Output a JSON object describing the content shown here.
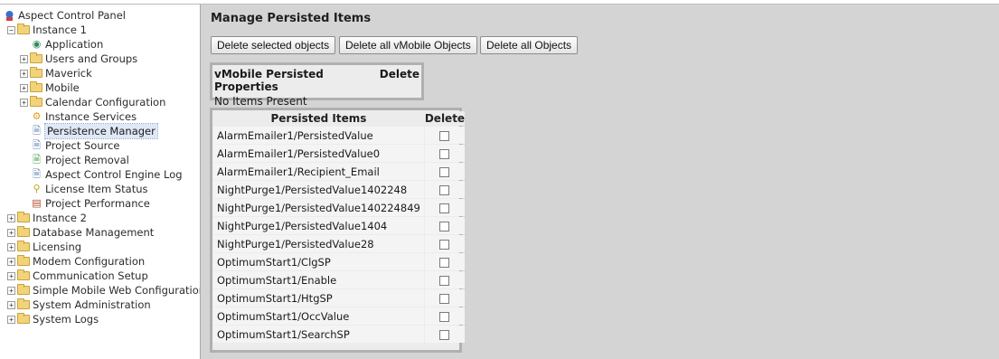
{
  "sidebar": {
    "root_label": "Aspect Control Panel",
    "instance1": {
      "label": "Instance 1",
      "children": [
        {
          "label": "Application",
          "type": "app",
          "expandable": false
        },
        {
          "label": "Users and Groups",
          "type": "folder",
          "expandable": true
        },
        {
          "label": "Maverick",
          "type": "folder",
          "expandable": true
        },
        {
          "label": "Mobile",
          "type": "folder",
          "expandable": true
        },
        {
          "label": "Calendar Configuration",
          "type": "folder",
          "expandable": true
        },
        {
          "label": "Instance Services",
          "type": "gear",
          "expandable": false
        },
        {
          "label": "Persistence Manager",
          "type": "doc",
          "expandable": false,
          "selected": true
        },
        {
          "label": "Project Source",
          "type": "doc",
          "expandable": false
        },
        {
          "label": "Project Removal",
          "type": "doc",
          "expandable": false
        },
        {
          "label": "Aspect Control Engine Log",
          "type": "doc",
          "expandable": false
        },
        {
          "label": "License Item Status",
          "type": "key",
          "expandable": false
        },
        {
          "label": "Project Performance",
          "type": "chart",
          "expandable": false
        }
      ]
    },
    "top_items": [
      "Instance 2",
      "Database Management",
      "Licensing",
      "Modem Configuration",
      "Communication Setup",
      "Simple Mobile Web Configuration",
      "System Administration",
      "System Logs"
    ]
  },
  "main": {
    "title": "Manage Persisted Items",
    "buttons": {
      "delete_selected": "Delete selected objects",
      "delete_all_vmobile": "Delete all vMobile Objects",
      "delete_all": "Delete all Objects"
    },
    "vmobile": {
      "header_name": "vMobile Persisted Properties",
      "header_delete": "Delete",
      "empty_text": "No Items Present"
    },
    "persisted": {
      "header_name": "Persisted Items",
      "header_delete": "Delete",
      "rows": [
        "AlarmEmailer1/PersistedValue",
        "AlarmEmailer1/PersistedValue0",
        "AlarmEmailer1/Recipient_Email",
        "NightPurge1/PersistedValue1402248",
        "NightPurge1/PersistedValue140224849",
        "NightPurge1/PersistedValue1404",
        "NightPurge1/PersistedValue28",
        "OptimumStart1/ClgSP",
        "OptimumStart1/Enable",
        "OptimumStart1/HtgSP",
        "OptimumStart1/OccValue",
        "OptimumStart1/SearchSP"
      ]
    }
  },
  "colors": {
    "background": "#d4d4d4",
    "sidebar_bg": "#ffffff",
    "folder": "#f3d37a",
    "selection": "#dfe8f6"
  }
}
